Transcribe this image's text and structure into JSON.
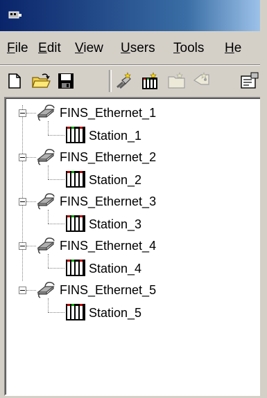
{
  "menu": [
    "File",
    "Edit",
    "View",
    "Users",
    "Tools",
    "He"
  ],
  "toolbar": [
    "new-icon",
    "open-icon",
    "save-icon",
    "wizard-icon",
    "device-icon",
    "folder-icon",
    "tag-icon",
    "properties-icon"
  ],
  "tree": [
    {
      "label": "FINS_Ethernet_1",
      "child": "Station_1"
    },
    {
      "label": "FINS_Ethernet_2",
      "child": "Station_2"
    },
    {
      "label": "FINS_Ethernet_3",
      "child": "Station_3"
    },
    {
      "label": "FINS_Ethernet_4",
      "child": "Station_4"
    },
    {
      "label": "FINS_Ethernet_5",
      "child": "Station_5"
    }
  ],
  "colors": {
    "title_dark": "#0a246a",
    "title_light": "#a6caf0",
    "face": "#d4d0c8",
    "station_red": "#c00000",
    "station_green": "#00a000"
  }
}
